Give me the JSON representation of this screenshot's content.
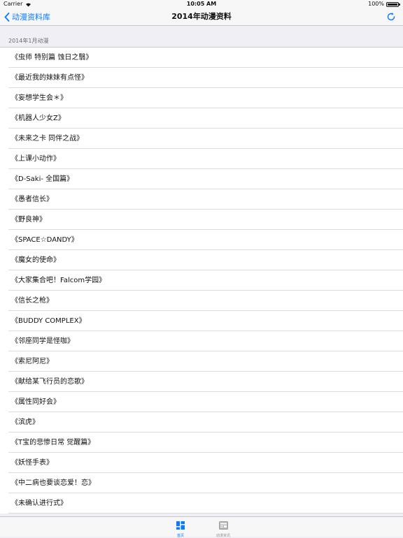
{
  "status_bar": {
    "carrier": "Carrier",
    "time": "10:05 AM",
    "battery": "100%"
  },
  "nav": {
    "back_label": "动漫资料库",
    "title": "2014年动漫资料"
  },
  "section": {
    "title": "2014年1月动漫"
  },
  "items": [
    "《虫师 特别篇 蚀日之翳》",
    "《最近我的妹妹有点怪》",
    "《妄想学生会＊》",
    "《机器人少女Z》",
    "《未来之卡 同伴之战》",
    "《上课小动作》",
    "《D-Saki- 全国篇》",
    "《愚者信长》",
    "《野良神》",
    "《SPACE☆DANDY》",
    "《魔女的使命》",
    "《大家集合吧！Falcom学园》",
    "《信长之枪》",
    "《BUDDY COMPLEX》",
    "《邻座同学是怪咖》",
    "《索尼阿尼》",
    "《献给某飞行员的恋歌》",
    "《属性同好会》",
    "《滨虎》",
    "《T宝的悲惨日常 觉醒篇》",
    "《妖怪手表》",
    "《中二病也要谈恋爱！恋》",
    "《未确认进行式》"
  ],
  "tabs": {
    "home_label": "首页",
    "news_label": "动漫资讯"
  },
  "colors": {
    "accent": "#0a7aff",
    "inactive": "#8e8e93"
  }
}
